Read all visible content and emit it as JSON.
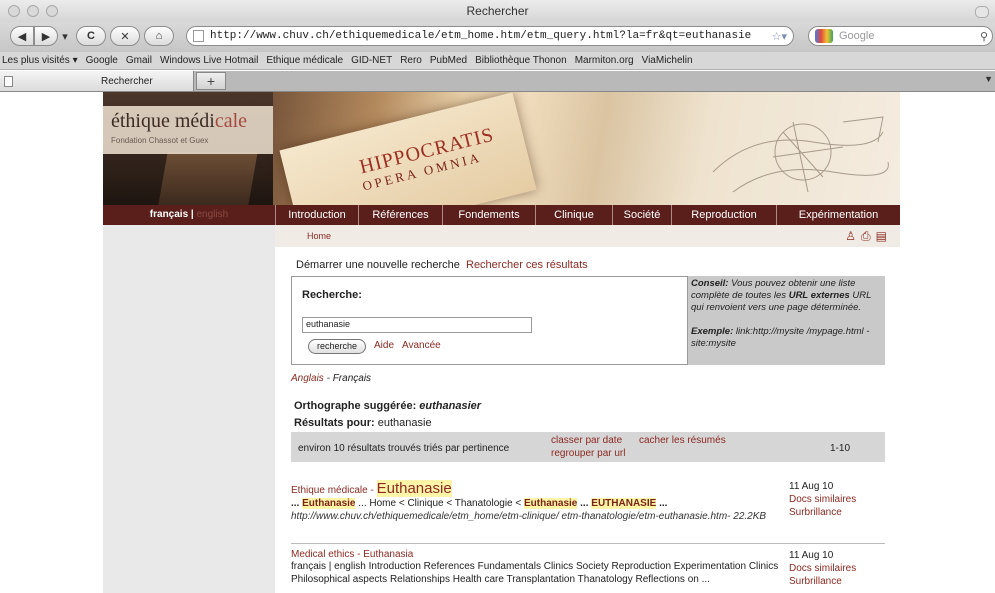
{
  "browser": {
    "window_title": "Rechercher",
    "url": "http://www.chuv.ch/ethiquemedicale/etm_home.htm/etm_query.html?la=fr&qt=euthanasie",
    "search_placeholder": "Google",
    "bookmarks": [
      "Les plus visités ▾",
      "Google",
      "Gmail",
      "Windows Live Hotmail",
      "Ethique médicale",
      "GID-NET",
      "Rero",
      "PubMed",
      "Bibliothèque Thonon",
      "Marmiton.org",
      "ViaMichelin"
    ],
    "tab_label": "Rechercher",
    "new_tab": "+"
  },
  "site": {
    "title_main": "éthique médi",
    "title_accent": "cale",
    "subtitle": "Fondation Chassot et Guex",
    "banner_text1": "HIPPOCRATIS",
    "banner_text2": "OPERA OMNIA",
    "lang_fr": "français",
    "lang_sep": " | ",
    "lang_en": "english",
    "nav": [
      "Introduction",
      "Références",
      "Fondements",
      "Clinique",
      "Société",
      "Reproduction",
      "Expérimentation"
    ],
    "breadcrumb": "Home"
  },
  "search": {
    "new_search": "Démarrer une nouvelle recherche",
    "search_results": "Rechercher ces résultats",
    "label": "Recherche:",
    "query": "euthanasie",
    "button": "recherche",
    "help": "Aide",
    "advanced": "Avancée",
    "tip_title": "Conseil:",
    "tip_text1": " Vous pouvez obtenir une liste complète de toutes les ",
    "tip_bold": "URL externes",
    "tip_text2": " URL qui renvoient vers une page déterminée.",
    "example_label": "Exemple:",
    "example_text": " link:http://mysite /mypage.html -site:mysite",
    "translit_lang": "Anglais",
    "translit_sep": " - ",
    "translit_current": "Français",
    "suggest_label": "Orthographe suggérée: ",
    "suggest_value": "euthanasier",
    "results_label": "Résultats pour:",
    "results_value": " euthanasie",
    "count_text": "environ 10 résultats trouvés triés par pertinence",
    "sort_date": "classer par date",
    "hide_summaries": "cacher les résumés",
    "group_url": "regrouper par url",
    "range": "1-10"
  },
  "results": [
    {
      "title_prefix": "Ethique médicale - ",
      "title_main": "Euthanasie",
      "snippet_parts": [
        "... ",
        "Euthanasie",
        " ... Home < Clinique < Thanatologie < ",
        "Euthanasie",
        " ... ",
        "EUTHANASIE",
        " ..."
      ],
      "url": "http://www.chuv.ch/ethiquemedicale/etm_home/etm-clinique/ etm-thanatologie/etm-euthanasie.htm- 22.2KB",
      "date": "11 Aug 10",
      "similar": "Docs similaires",
      "highlight": "Surbrillance"
    },
    {
      "title_prefix": "Medical ethics - ",
      "title_main": "Euthanasia",
      "snippet": "français | english Introduction References Fundamentals Clinics Society Reproduction Experimentation Clinics Philosophical aspects Relationships Health care Transplantation Thanatology Reflections on ...",
      "date": "11 Aug 10",
      "similar": "Docs similaires",
      "highlight": "Surbrillance"
    }
  ]
}
